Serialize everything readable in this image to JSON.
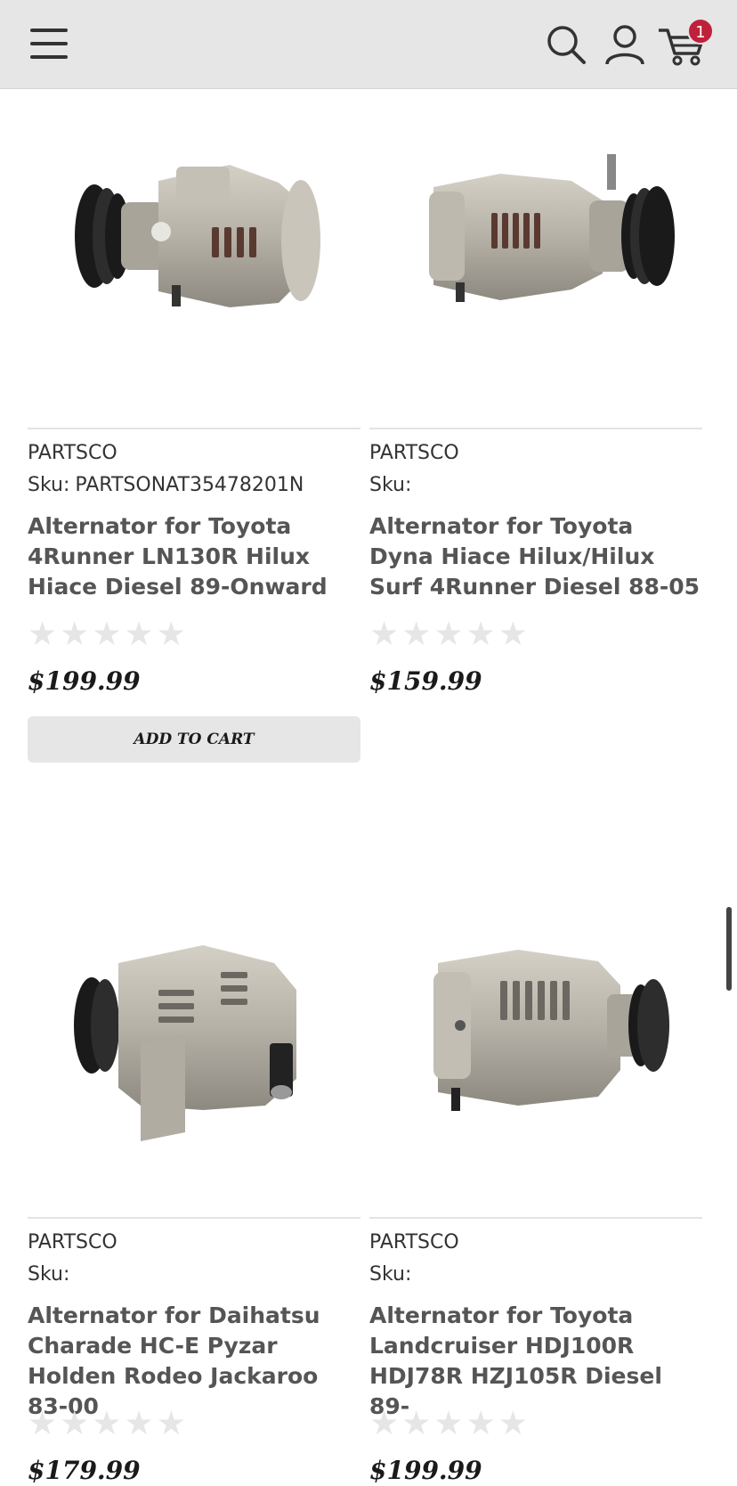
{
  "header": {
    "menu_icon": "hamburger-menu-icon",
    "search_icon": "search-icon",
    "account_icon": "user-icon",
    "cart_icon": "cart-icon",
    "cart_count": "1"
  },
  "products": [
    {
      "brand": "PARTSCO",
      "sku_label": "Sku:",
      "sku": "PARTSONAT35478201N",
      "title": "Alternator for Toyota 4Runner LN130R Hilux Hiace Diesel 89-Onward",
      "rating": 0,
      "price": "$199.99",
      "button": "ADD TO CART"
    },
    {
      "brand": "PARTSCO",
      "sku_label": "Sku:",
      "sku": "",
      "title": "Alternator for Toyota Dyna Hiace Hilux/Hilux Surf 4Runner Diesel 88-05",
      "rating": 0,
      "price": "$159.99"
    },
    {
      "brand": "PARTSCO",
      "sku_label": "Sku:",
      "sku": "",
      "title": "Alternator for Daihatsu Charade HC-E Pyzar Holden Rodeo Jackaroo 83-00",
      "rating": 0,
      "price": "$179.99"
    },
    {
      "brand": "PARTSCO",
      "sku_label": "Sku:",
      "sku": "",
      "title": "Alternator for Toyota Landcruiser HDJ100R HDJ78R HZJ105R Diesel 89-",
      "rating": 0,
      "price": "$199.99"
    }
  ],
  "colors": {
    "badge": "#c0203a",
    "header_bg": "#e6e6e6",
    "button_bg": "#e6e6e6"
  }
}
